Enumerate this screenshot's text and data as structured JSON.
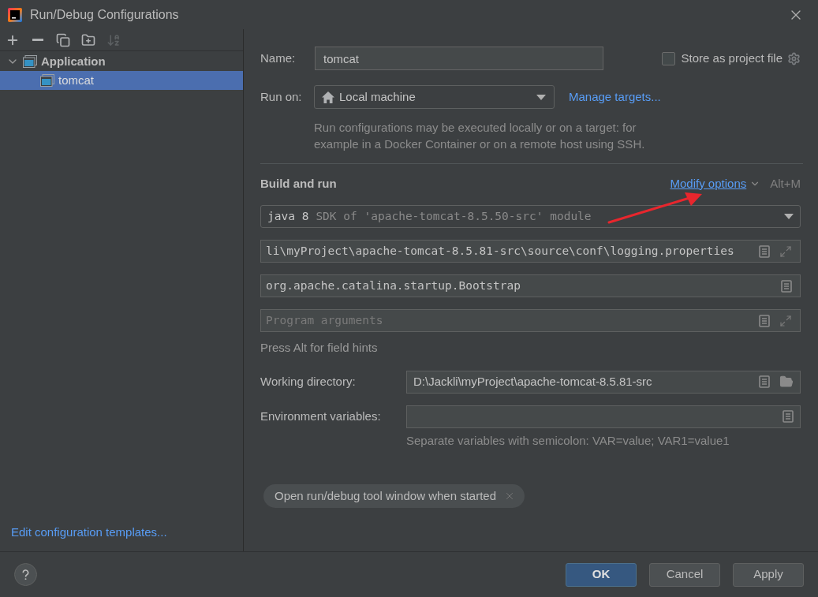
{
  "window": {
    "title": "Run/Debug Configurations"
  },
  "toolbar": [
    {
      "kind": "add",
      "disabled": false
    },
    {
      "kind": "remove",
      "disabled": false
    },
    {
      "kind": "copy",
      "disabled": false
    },
    {
      "kind": "new-folder",
      "disabled": false
    },
    {
      "kind": "sort",
      "disabled": true
    }
  ],
  "tree": [
    {
      "label": "Application",
      "expanded": true,
      "selected": false,
      "children": [
        {
          "label": "tomcat",
          "selected": true
        }
      ]
    }
  ],
  "templates_link": "Edit configuration templates...",
  "form": {
    "name": {
      "label": "Name:",
      "value": "tomcat"
    },
    "store_as_project_file": {
      "label": "Store as project file",
      "checked": false
    },
    "run_on": {
      "label": "Run on:",
      "value": "Local machine",
      "link": "Manage targets...",
      "description": "Run configurations may be executed locally or on a target: for example in a Docker Container or on a remote host using SSH."
    },
    "build_and_run": {
      "title": "Build and run",
      "modify_options": "Modify options",
      "shortcut": "Alt+M",
      "fields": [
        {
          "kind": "sdk",
          "value": "java 8",
          "detail": "SDK of 'apache-tomcat-8.5.50-src' module"
        },
        {
          "kind": "expandable",
          "value": "li\\myProject\\apache-tomcat-8.5.81-src\\source\\conf\\logging.properties"
        },
        {
          "kind": "text",
          "value": "org.apache.catalina.startup.Bootstrap"
        },
        {
          "kind": "expandable",
          "placeholder": "Program arguments"
        }
      ],
      "hint": "Press Alt for field hints"
    },
    "rows": [
      {
        "kind": "path",
        "label": "Working directory:",
        "value": "D:\\Jackli\\myProject\\apache-tomcat-8.5.81-src"
      },
      {
        "kind": "text",
        "label": "Environment variables:",
        "hint": "Separate variables with semicolon: VAR=value; VAR1=value1"
      }
    ],
    "options": [
      {
        "label": "Open run/debug tool window when started"
      }
    ]
  },
  "buttons": [
    {
      "label": "OK",
      "kind": "primary"
    },
    {
      "label": "Cancel",
      "kind": "secondary"
    },
    {
      "label": "Apply",
      "kind": "secondary"
    }
  ]
}
